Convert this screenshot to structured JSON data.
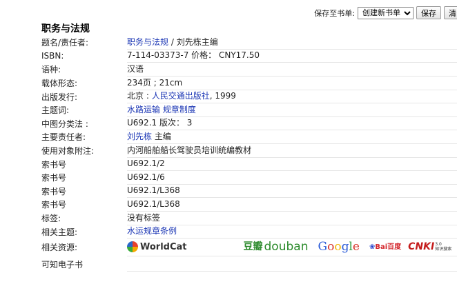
{
  "toolbar": {
    "save_to_list_label": "保存至书单:",
    "list_select_value": "创建新书单",
    "save_button": "保存",
    "cut_button": "清"
  },
  "book": {
    "title": "职务与法规",
    "fields": [
      {
        "key": "title",
        "label": "题名/责任者:",
        "parts": [
          {
            "text": "职务与法规",
            "link": true
          },
          {
            "text": " / 刘先栋主编",
            "link": false
          }
        ]
      },
      {
        "key": "isbn",
        "label": "ISBN:",
        "parts": [
          {
            "text": "7-114-03373-7 价格：  CNY17.50",
            "link": false
          }
        ]
      },
      {
        "key": "language",
        "label": "语种:",
        "parts": [
          {
            "text": "汉语",
            "link": false
          }
        ]
      },
      {
        "key": "physical",
        "label": "载体形态:",
        "parts": [
          {
            "text": "234页 ; 21cm",
            "link": false
          }
        ]
      },
      {
        "key": "publisher",
        "label": "出版发行:",
        "parts": [
          {
            "text": "北京 : ",
            "link": false
          },
          {
            "text": "人民交通出版社",
            "link": true
          },
          {
            "text": ", 1999",
            "link": false
          }
        ]
      },
      {
        "key": "subjects",
        "label": "主题词:",
        "parts": [
          {
            "text": "水路运输",
            "link": true
          },
          {
            "text": " ",
            "link": false
          },
          {
            "text": "规章制度",
            "link": true
          }
        ]
      },
      {
        "key": "clc",
        "label": "中图分类法 :",
        "parts": [
          {
            "text": "U692.1 版次：  3",
            "link": false
          }
        ]
      },
      {
        "key": "author",
        "label": "主要责任者:",
        "parts": [
          {
            "text": "刘先栋",
            "link": true
          },
          {
            "text": " 主编",
            "link": false
          }
        ]
      },
      {
        "key": "audience",
        "label": "使用对象附注:",
        "parts": [
          {
            "text": "内河船舶船长驾驶员培训统编教材",
            "link": false
          }
        ]
      },
      {
        "key": "callno1",
        "label": "索书号",
        "parts": [
          {
            "text": "U692.1/2",
            "link": false
          }
        ]
      },
      {
        "key": "callno2",
        "label": "索书号",
        "parts": [
          {
            "text": "U692.1/6",
            "link": false
          }
        ]
      },
      {
        "key": "callno3",
        "label": "索书号",
        "parts": [
          {
            "text": "U692.1/L368",
            "link": false
          }
        ]
      },
      {
        "key": "callno4",
        "label": "索书号",
        "parts": [
          {
            "text": "U692.1/L368",
            "link": false
          }
        ]
      },
      {
        "key": "tags",
        "label": "标签:",
        "parts": [
          {
            "text": "没有标签",
            "link": false
          }
        ]
      },
      {
        "key": "related_subject",
        "label": "相关主题:",
        "parts": [
          {
            "text": "水运规章条例",
            "link": true
          }
        ]
      }
    ],
    "resources_label": "相关资源:",
    "ebook_label": "可知电子书"
  },
  "resources": {
    "worldcat": "WorldCat",
    "douban_cn": "豆瓣",
    "douban_en": "douban",
    "google": [
      "G",
      "o",
      "o",
      "g",
      "l",
      "e"
    ],
    "baidu": "Bai百度",
    "cnki": "CNKI",
    "cnki_sub": "知识搜索",
    "cnki_ver": "3.0"
  }
}
